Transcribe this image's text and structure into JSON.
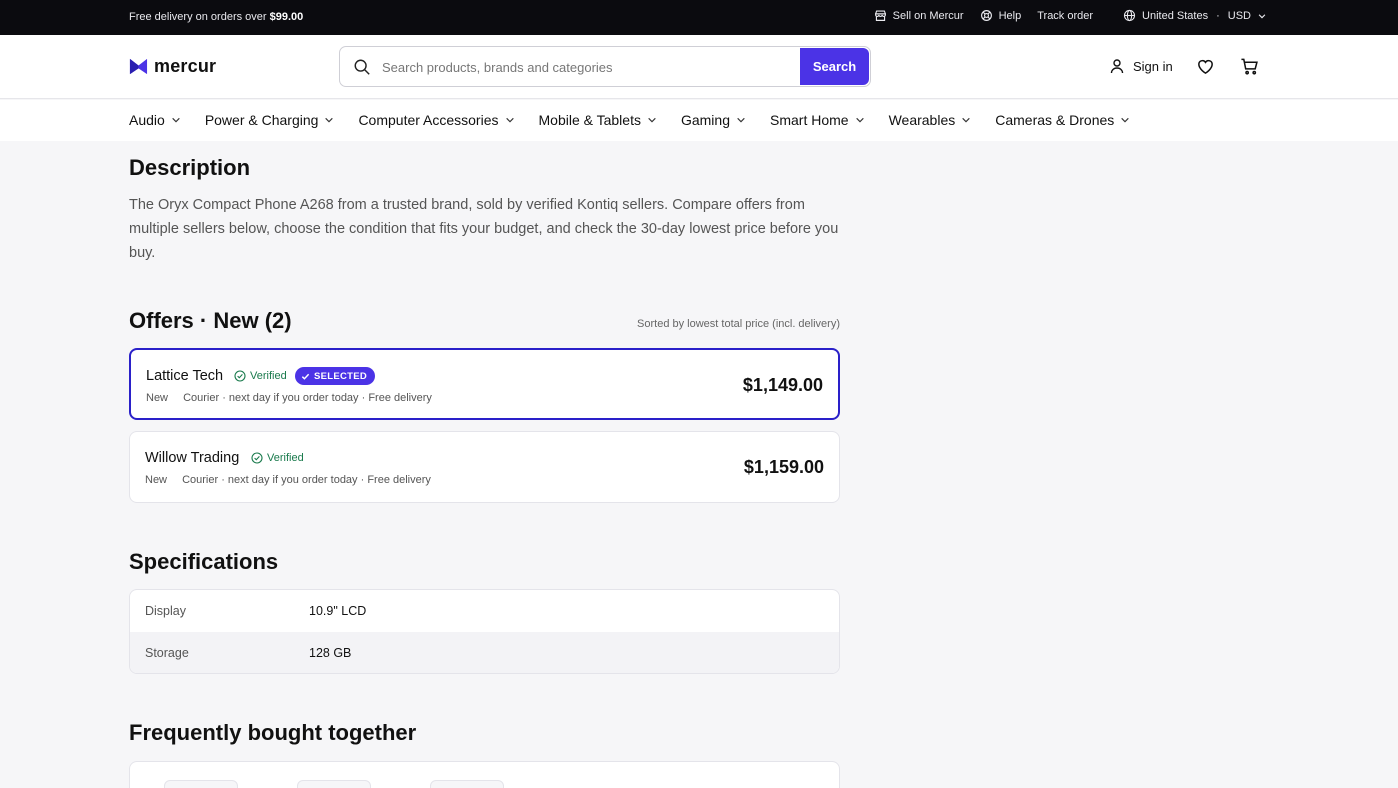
{
  "topbar": {
    "promo_prefix": "Free delivery on orders over",
    "promo_amount": "$99.00",
    "sell": "Sell on Mercur",
    "help": "Help",
    "track": "Track order",
    "country": "United States",
    "currency": "USD"
  },
  "header": {
    "brand": "mercur",
    "search_placeholder": "Search products, brands and categories",
    "search_button": "Search",
    "sign_in": "Sign in"
  },
  "nav": {
    "items": [
      {
        "label": "Audio"
      },
      {
        "label": "Power & Charging"
      },
      {
        "label": "Computer Accessories"
      },
      {
        "label": "Mobile & Tablets"
      },
      {
        "label": "Gaming"
      },
      {
        "label": "Smart Home"
      },
      {
        "label": "Wearables"
      },
      {
        "label": "Cameras & Drones"
      }
    ]
  },
  "description": {
    "title": "Description",
    "text": "The Oryx Compact Phone A268 from a trusted brand, sold by verified Kontiq sellers. Compare offers from multiple sellers below, choose the condition that fits your budget, and check the 30-day lowest price before you buy."
  },
  "offers": {
    "title": "Offers · New (2)",
    "sorted_note": "Sorted by lowest total price (incl. delivery)",
    "verified_label": "Verified",
    "selected_label": "SELECTED",
    "items": [
      {
        "seller": "Lattice Tech",
        "condition": "New",
        "delivery": "Courier · next day if you order today · Free delivery",
        "price": "$1,149.00",
        "selected": true
      },
      {
        "seller": "Willow Trading",
        "condition": "New",
        "delivery": "Courier · next day if you order today · Free delivery",
        "price": "$1,159.00",
        "selected": false
      }
    ]
  },
  "specifications": {
    "title": "Specifications",
    "rows": [
      {
        "key": "Display",
        "value": "10.9\" LCD"
      },
      {
        "key": "Storage",
        "value": "128 GB"
      }
    ]
  },
  "fbt": {
    "title": "Frequently bought together"
  },
  "colors": {
    "accent": "#4b33e6",
    "verified": "#197a4c",
    "topbar": "#0b0b0f"
  }
}
